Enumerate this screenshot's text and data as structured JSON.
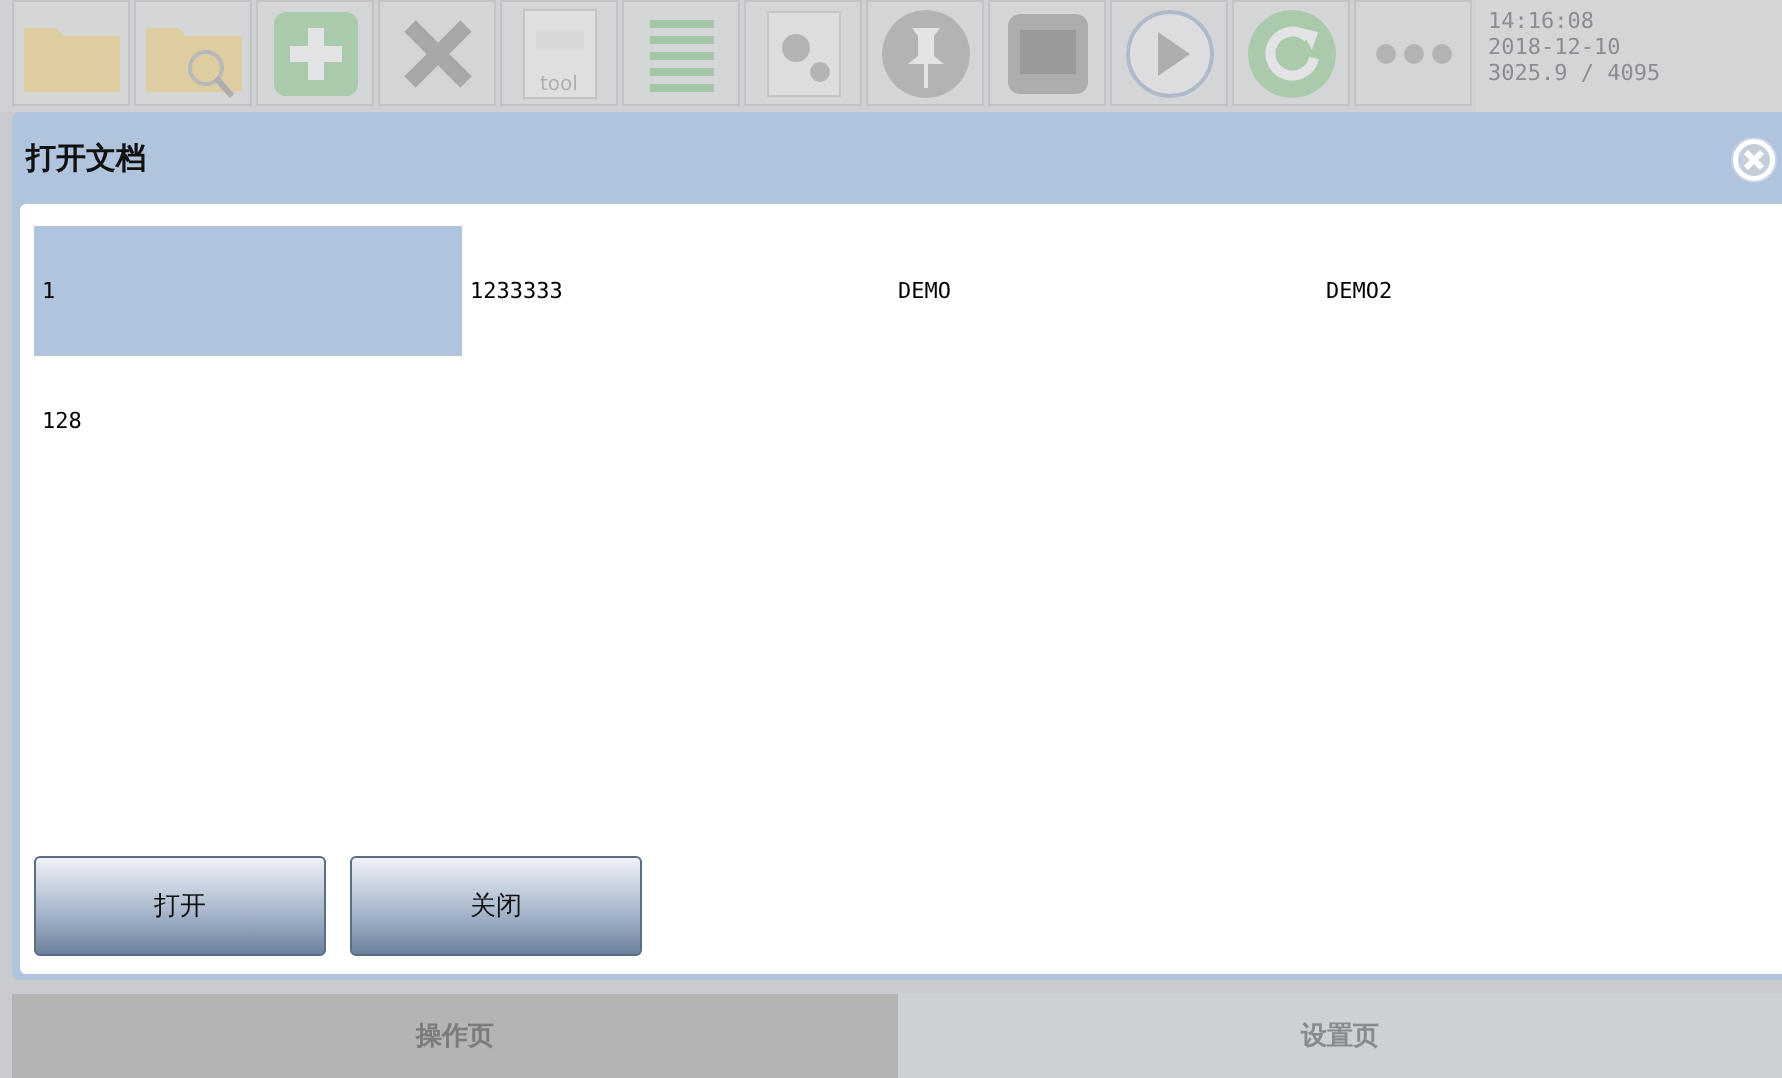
{
  "toolbar": {
    "buttons": [
      {
        "kind": "folder"
      },
      {
        "kind": "folder-search"
      },
      {
        "kind": "add"
      },
      {
        "kind": "delete"
      },
      {
        "kind": "tool",
        "label": "tool"
      },
      {
        "kind": "list"
      },
      {
        "kind": "settings"
      },
      {
        "kind": "pin"
      },
      {
        "kind": "model"
      },
      {
        "kind": "play"
      },
      {
        "kind": "refresh"
      },
      {
        "kind": "more"
      }
    ],
    "status": [
      "14:16:08",
      "2018-12-10",
      "3025.9 / 4095"
    ]
  },
  "dialog": {
    "title": "打开文档",
    "files": [
      {
        "name": "1",
        "selected": true
      },
      {
        "name": "1233333",
        "selected": false
      },
      {
        "name": "DEMO",
        "selected": false
      },
      {
        "name": "DEMO2",
        "selected": false
      },
      {
        "name": "128",
        "selected": false
      }
    ],
    "buttons": [
      "打开",
      "关闭"
    ]
  },
  "tabs": [
    {
      "label": "操作页",
      "selected": true
    },
    {
      "label": "设置页",
      "selected": false
    }
  ]
}
